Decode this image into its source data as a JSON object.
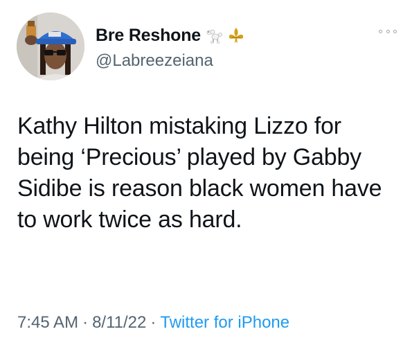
{
  "author": {
    "display_name": "Bre Reshone",
    "handle": "@Labreezeiana",
    "name_emojis": [
      "poodle-icon",
      "fleur-de-lis-icon"
    ],
    "avatar": "profile-photo"
  },
  "tweet": {
    "text": "Kathy Hilton mistaking Lizzo for being ‘Precious’ played by Gabby Sidibe is reason black women have to work twice as hard.",
    "time": "7:45 AM",
    "date": "8/11/22",
    "source": "Twitter for iPhone",
    "separator": "·"
  },
  "colors": {
    "text": "#0f1419",
    "secondary": "#536471",
    "link": "#1d9bf0"
  }
}
